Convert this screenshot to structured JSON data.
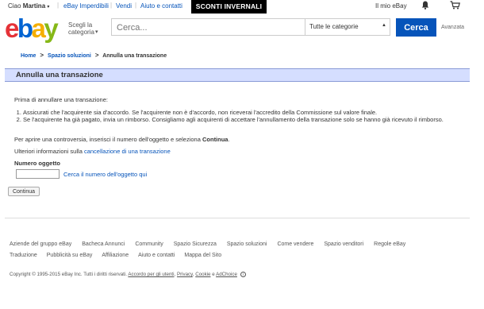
{
  "topbar": {
    "greeting_prefix": "Ciao",
    "user_name": "Martina",
    "caret": "▾",
    "links": [
      "eBay Imperdibili",
      "Vendi",
      "Aiuto e contatti"
    ],
    "promo": "SCONTI INVERNALI",
    "my_ebay": "Il mio eBay",
    "bell_icon": "bell-icon",
    "cart_icon": "cart-icon"
  },
  "header": {
    "logo": {
      "e": "e",
      "b": "b",
      "a": "a",
      "y": "y"
    },
    "category_label": "Scegli la categoria",
    "search_placeholder": "Cerca...",
    "search_category": "Tutte le categorie",
    "search_button": "Cerca",
    "advanced": "Avanzata"
  },
  "breadcrumb": {
    "items": [
      "Home",
      "Spazio soluzioni",
      "Annulla una transazione"
    ],
    "separator": ">"
  },
  "page": {
    "title": "Annulla una transazione",
    "intro": "Prima di annullare una transazione:",
    "steps": [
      "Assicurati che l'acquirente sia d'accordo. Se l'acquirente non è d'accordo, non riceverai l'accredito della Commissione sul valore finale.",
      "Se l'acquirente ha già pagato, invia un rimborso. Consigliamo agli acquirenti di accettare l'annullamento della transazione solo se hanno già ricevuto il rimborso."
    ],
    "dispute_text": "Per aprire una controversia, inserisci il numero dell'oggetto e seleziona ",
    "dispute_bold": "Continua",
    "dispute_end": ".",
    "more_info_text": "Ulteriori informazioni sulla ",
    "more_info_link": "cancellazione di una transazione",
    "item_label": "Numero oggetto",
    "item_value": "",
    "find_link": "Cerca il numero dell'oggetto qui",
    "continue_button": "Continua"
  },
  "footer": {
    "links": [
      "Aziende del gruppo eBay",
      "Bacheca Annunci",
      "Community",
      "Spazio Sicurezza",
      "Spazio soluzioni",
      "Come vendere",
      "Spazio venditori",
      "Regole eBay",
      "Traduzione",
      "Pubblicità su eBay",
      "Affiliazione",
      "Aiuto e contatti",
      "Mappa del Sito"
    ],
    "copyright_prefix": "Copyright © 1995-2015 eBay Inc. Tutti i diritti riservati.",
    "agreement": "Accordo per gli utenti",
    "privacy": "Privacy",
    "cookie": "Cookie",
    "and": "e",
    "adchoice": "AdChoice",
    "adchoice_symbol": "i"
  },
  "colors": {
    "brand_blue": "#0654ba",
    "title_bar_bg": "#d5deff",
    "logo_red": "#e53238",
    "logo_blue": "#0064d2",
    "logo_yellow": "#f5af02",
    "logo_green": "#86b817"
  }
}
